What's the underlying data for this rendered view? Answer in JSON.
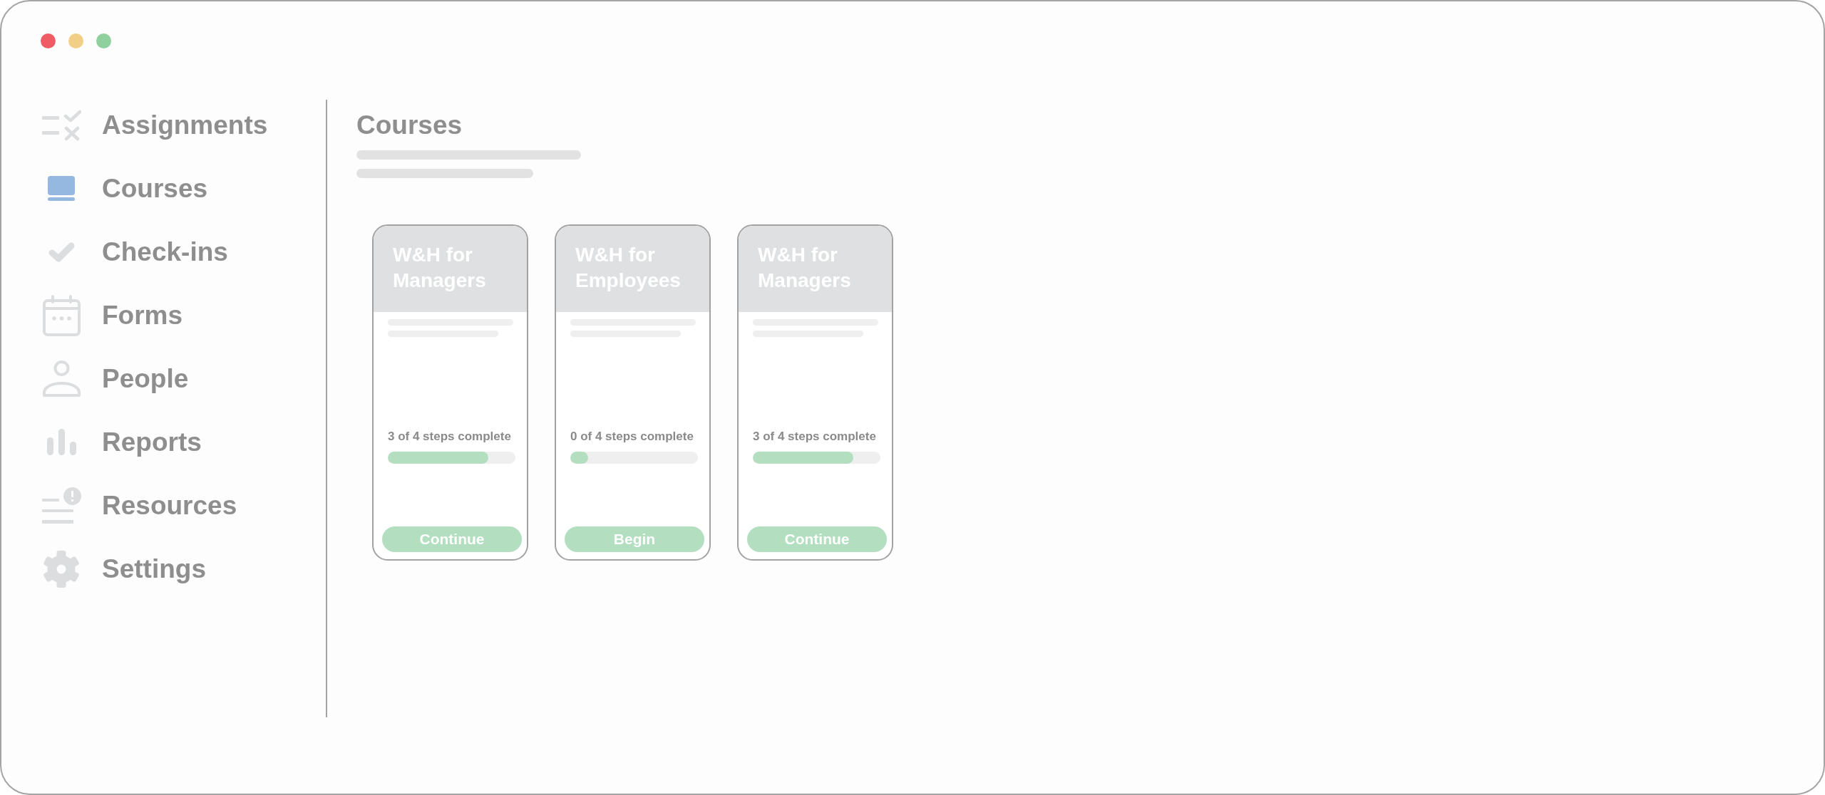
{
  "window": {
    "controls": [
      {
        "color": "#f05c66"
      },
      {
        "color": "#f2cf86"
      },
      {
        "color": "#8fd09f"
      }
    ]
  },
  "sidebar": {
    "items": [
      {
        "label": "Assignments",
        "selected": false
      },
      {
        "label": "Courses",
        "selected": true
      },
      {
        "label": "Check-ins",
        "selected": false
      },
      {
        "label": "Forms",
        "selected": false
      },
      {
        "label": "People",
        "selected": false
      },
      {
        "label": "Reports",
        "selected": false
      },
      {
        "label": "Resources",
        "selected": false
      },
      {
        "label": "Settings",
        "selected": false
      }
    ]
  },
  "main": {
    "title": "Courses",
    "courses": [
      {
        "title": "W&H for Managers",
        "progress": "3 of 4 steps complete",
        "level": 0.79,
        "button": "Continue"
      },
      {
        "title": "W&H for Employees",
        "progress": "0 of 4 steps complete",
        "level": 0.14,
        "button": "Begin"
      },
      {
        "title": "W&H for Managers",
        "progress": "3 of 4 steps complete",
        "level": 0.79,
        "button": "Continue"
      }
    ]
  }
}
